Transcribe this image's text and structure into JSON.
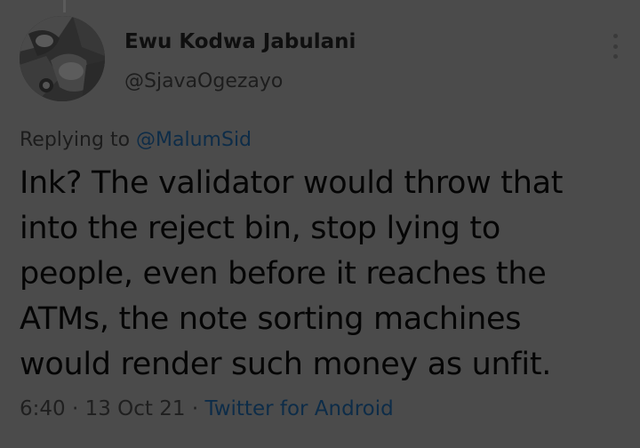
{
  "tweet": {
    "author": {
      "display_name": "Ewu Kodwa Jabulani",
      "handle": "@SjavaOgezayo"
    },
    "more_icon": "vertical-ellipsis-icon",
    "replying": {
      "prefix": "Replying to",
      "mention": "@MalumSid"
    },
    "text_lines": [
      "Ink? The validator would throw that",
      "into the reject bin, stop lying to",
      "people, even before it reaches the",
      "ATMs, the note sorting machines",
      "would render such money as unfit."
    ],
    "time": "6:40",
    "separator": "·",
    "date": "13 Oct 21",
    "source": "Twitter for Android"
  },
  "colors": {
    "background": "#4b4b4b",
    "text": "#050505",
    "link": "#0d2c48"
  }
}
